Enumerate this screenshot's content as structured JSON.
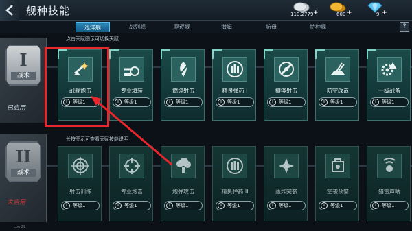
{
  "header": {
    "title": "舰种技能",
    "currencies": [
      {
        "icon": "silver-coin-icon",
        "amount": "110,2779"
      },
      {
        "icon": "gold-coin-icon",
        "amount": "600"
      },
      {
        "icon": "diamond-icon",
        "amount": "9"
      }
    ],
    "plus_label": "+"
  },
  "tabs": [
    {
      "label": "巡洋舰",
      "active": true
    },
    {
      "label": "战列舰",
      "active": false
    },
    {
      "label": "驱逐舰",
      "active": false
    },
    {
      "label": "潜艇",
      "active": false
    },
    {
      "label": "航母",
      "active": false
    },
    {
      "label": "特种舰",
      "active": false
    }
  ],
  "help_label": "?",
  "tiers": [
    {
      "numeral": "I",
      "name": "战术",
      "status": "已启用",
      "hint": "点击天赋图示可切换天赋",
      "skills": [
        {
          "name": "战舰炮击",
          "level": "等级1",
          "icon": "cannon-fire-icon"
        },
        {
          "name": "专业填装",
          "level": "等级1",
          "icon": "artillery-icon"
        },
        {
          "name": "燃烧射击",
          "level": "等级1",
          "icon": "flame-shell-icon"
        },
        {
          "name": "精良弹药 I",
          "level": "等级1",
          "icon": "ammo-icon"
        },
        {
          "name": "瘫痪射击",
          "level": "等级1",
          "icon": "crosshair-shot-icon"
        },
        {
          "name": "防空改造",
          "level": "等级1",
          "icon": "aa-gun-icon"
        },
        {
          "name": "一级战备",
          "level": "等级1",
          "icon": "gear-alert-icon"
        }
      ]
    },
    {
      "numeral": "II",
      "name": "战术",
      "status": "未启用",
      "hint": "长按图示可查看天赋技能说明",
      "skills": [
        {
          "name": "射击训练",
          "level": "等级1",
          "icon": "target-icon"
        },
        {
          "name": "专业炮击",
          "level": "等级1",
          "icon": "crosshair-icon"
        },
        {
          "name": "炮弹攻击",
          "level": "等级1",
          "icon": "explosion-icon"
        },
        {
          "name": "精良弹药 II",
          "level": "等级1",
          "icon": "ammo-icon"
        },
        {
          "name": "轰炸突袭",
          "level": "等级1",
          "icon": "bomb-raid-icon"
        },
        {
          "name": "空袭预警",
          "level": "等级1",
          "icon": "radar-warning-icon"
        },
        {
          "name": "猎雷声呐",
          "level": "等级1",
          "icon": "sonar-icon"
        }
      ]
    }
  ],
  "level_badge": "I",
  "footer": "Lpo 29",
  "colors": {
    "accent_tab": "#2a86b8",
    "card_active": "#1a4a48",
    "highlight": "#e8262b",
    "inactive_status": "#c23b3b"
  }
}
